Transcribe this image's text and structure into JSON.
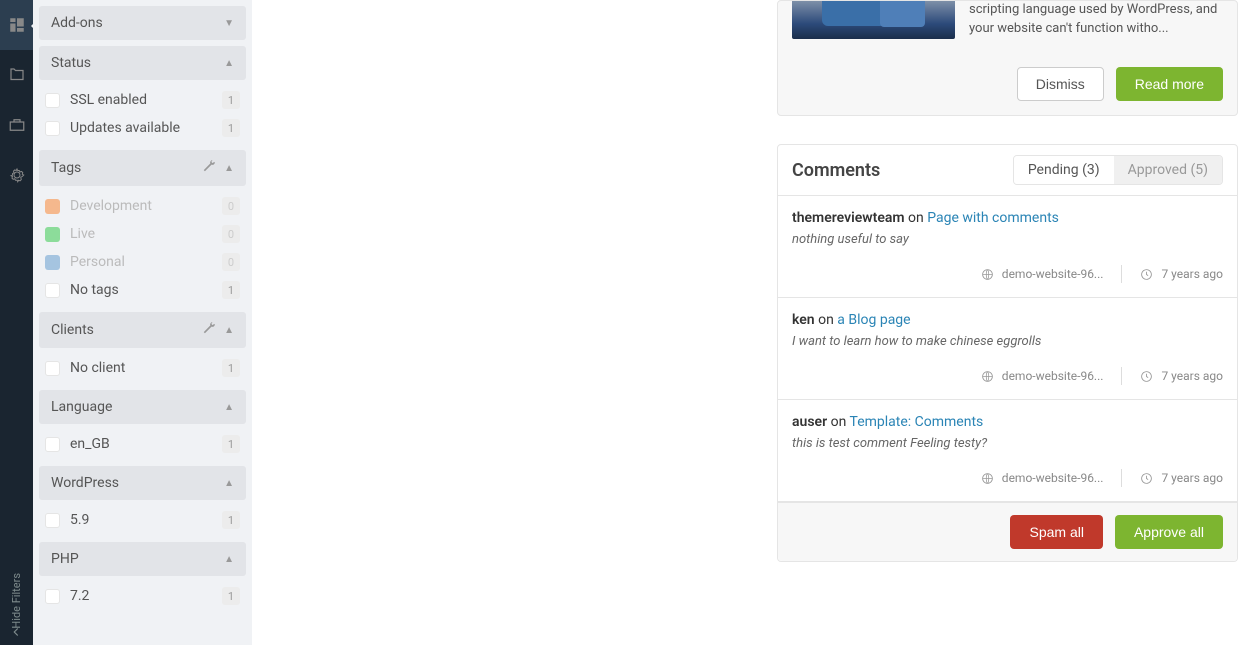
{
  "sidebar_toggle": "Hide Filters",
  "filters": {
    "addons": {
      "title": "Add-ons",
      "collapsed": true
    },
    "status": {
      "title": "Status",
      "items": [
        {
          "label": "SSL enabled",
          "count": "1"
        },
        {
          "label": "Updates available",
          "count": "1"
        }
      ]
    },
    "tags": {
      "title": "Tags",
      "items": [
        {
          "label": "Development",
          "count": "0",
          "color": "#f5b88d",
          "dim": true
        },
        {
          "label": "Live",
          "count": "0",
          "color": "#8cdc9a",
          "dim": true
        },
        {
          "label": "Personal",
          "count": "0",
          "color": "#a5c4e0",
          "dim": true
        },
        {
          "label": "No tags",
          "count": "1",
          "color": "#ffffff",
          "dim": false,
          "border": true
        }
      ]
    },
    "clients": {
      "title": "Clients",
      "items": [
        {
          "label": "No client",
          "count": "1"
        }
      ]
    },
    "language": {
      "title": "Language",
      "items": [
        {
          "label": "en_GB",
          "count": "1"
        }
      ]
    },
    "wordpress": {
      "title": "WordPress",
      "items": [
        {
          "label": "5.9",
          "count": "1"
        }
      ]
    },
    "php": {
      "title": "PHP",
      "items": [
        {
          "label": "7.2",
          "count": "1"
        }
      ]
    }
  },
  "notice": {
    "text": "scripting language used by WordPress, and your website can't function witho...",
    "dismiss": "Dismiss",
    "read_more": "Read more"
  },
  "comments_panel": {
    "title": "Comments",
    "tabs": {
      "pending": "Pending (3)",
      "approved": "Approved (5)"
    },
    "comments": [
      {
        "author": "themereviewteam",
        "on": "on",
        "link": "Page with comments",
        "body": "nothing useful to say",
        "site": "demo-website-96...",
        "time": "7 years ago"
      },
      {
        "author": "ken",
        "on": "on",
        "link": "a Blog page",
        "body": "I want to learn how to make chinese eggrolls",
        "site": "demo-website-96...",
        "time": "7 years ago"
      },
      {
        "author": "auser",
        "on": "on",
        "link": "Template: Comments",
        "body": "this is test comment Feeling testy?",
        "site": "demo-website-96...",
        "time": "7 years ago"
      }
    ],
    "spam_all": "Spam all",
    "approve_all": "Approve all"
  }
}
